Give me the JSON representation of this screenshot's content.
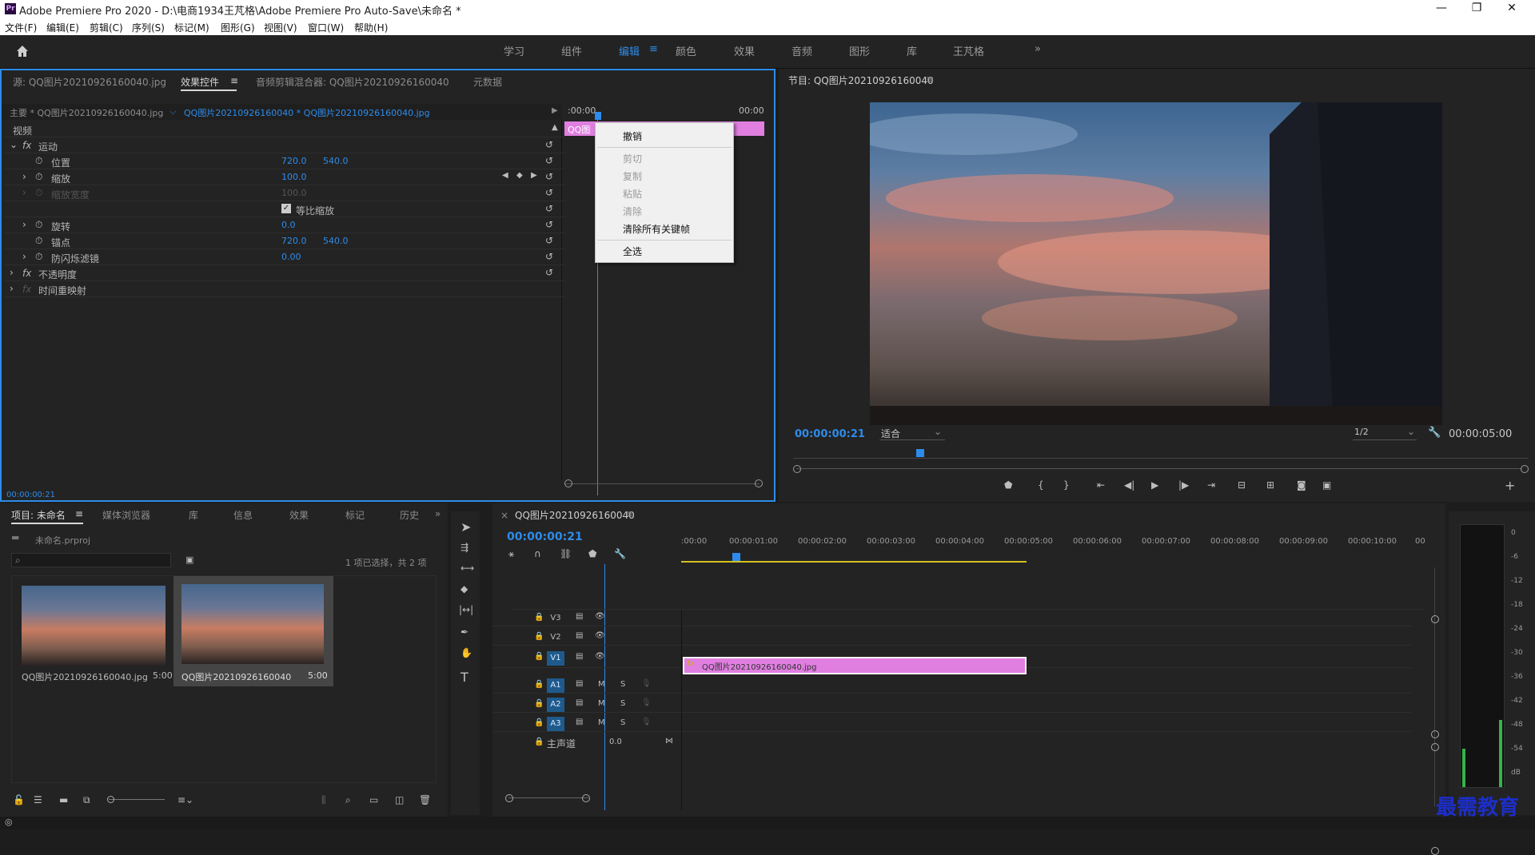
{
  "window": {
    "title": "Adobe Premiere Pro 2020 - D:\\电商1934王芃格\\Adobe Premiere Pro Auto-Save\\未命名 *",
    "app_icon": "Pr",
    "min": "—",
    "max": "❐",
    "close": "✕"
  },
  "menu": [
    "文件(F)",
    "编辑(E)",
    "剪辑(C)",
    "序列(S)",
    "标记(M)",
    "图形(G)",
    "视图(V)",
    "窗口(W)",
    "帮助(H)"
  ],
  "workspaces": {
    "items": [
      "学习",
      "组件",
      "编辑",
      "颜色",
      "效果",
      "音频",
      "图形",
      "库",
      "王芃格"
    ],
    "active": "编辑",
    "more": "»"
  },
  "source_panel": {
    "tabs": [
      "源: QQ图片20210926160040.jpg",
      "效果控件",
      "音频剪辑混合器: QQ图片20210926160040",
      "元数据"
    ],
    "master": "主要 * QQ图片20210926160040.jpg",
    "clip": "QQ图片20210926160040 * QQ图片20210926160040.jpg",
    "time_start": ":00:00",
    "time_end": "00:00",
    "clip_label": "QQ图",
    "section": "视频",
    "motion": "运动",
    "position": "位置",
    "pos_x": "720.0",
    "pos_y": "540.0",
    "scale": "缩放",
    "scale_v": "100.0",
    "scale_w": "缩放宽度",
    "scale_w_v": "100.0",
    "uniform": "等比缩放",
    "rotation": "旋转",
    "rotation_v": "0.0",
    "anchor": "锚点",
    "anc_x": "720.0",
    "anc_y": "540.0",
    "flicker": "防闪烁滤镜",
    "flicker_v": "0.00",
    "opacity": "不透明度",
    "remap": "时间重映射",
    "current_time": "00:00:00:21"
  },
  "context_menu": {
    "undo": "撤销",
    "cut": "剪切",
    "copy": "复制",
    "paste": "粘贴",
    "clear": "清除",
    "clear_keys": "清除所有关键帧",
    "select_all": "全选"
  },
  "program": {
    "title": "节目: QQ图片20210926160040",
    "timecode": "00:00:00:21",
    "fit": "适合",
    "res": "1/2",
    "duration": "00:00:05:00"
  },
  "project": {
    "tabs": [
      "项目: 未命名",
      "媒体浏览器",
      "库",
      "信息",
      "效果",
      "标记",
      "历史"
    ],
    "file": "未命名.prproj",
    "selection": "1 项已选择，共 2 项",
    "items": [
      {
        "name": "QQ图片20210926160040.jpg",
        "dur": "5:00"
      },
      {
        "name": "QQ图片20210926160040",
        "dur": "5:00"
      }
    ]
  },
  "timeline": {
    "title": "QQ图片20210926160040",
    "timecode": "00:00:00:21",
    "ruler": [
      ":00:00",
      "00:00:01:00",
      "00:00:02:00",
      "00:00:03:00",
      "00:00:04:00",
      "00:00:05:00",
      "00:00:06:00",
      "00:00:07:00",
      "00:00:08:00",
      "00:00:09:00",
      "00:00:10:00",
      "00"
    ],
    "video_tracks": [
      "V3",
      "V2",
      "V1"
    ],
    "audio_tracks": [
      "A1",
      "A2",
      "A3"
    ],
    "master": "主声道",
    "master_v": "0.0",
    "clip": "QQ图片20210926160040.jpg",
    "m": "M",
    "s": "S"
  },
  "meter": {
    "labels": [
      "0",
      "-6",
      "-12",
      "-18",
      "-24",
      "-30",
      "-36",
      "-42",
      "-48",
      "-54",
      "dB"
    ]
  },
  "watermark": "最需教育"
}
